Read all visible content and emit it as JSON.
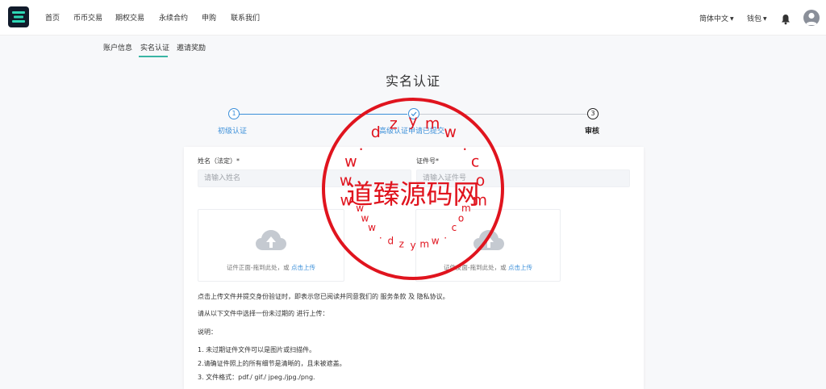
{
  "nav": {
    "items": [
      "首页",
      "币币交易",
      "期权交易",
      "永续合约",
      "申购",
      "联系我们"
    ],
    "language": "简体中文",
    "wallet": "钱包"
  },
  "subnav": {
    "tabs": [
      "账户信息",
      "实名认证",
      "邀请奖励"
    ],
    "active": "实名认证"
  },
  "page": {
    "title": "实名认证"
  },
  "steps": [
    {
      "number": "1",
      "label": "初级认证",
      "state": "done"
    },
    {
      "number": "2",
      "label": "高级认证申请已提交",
      "state": "done"
    },
    {
      "number": "3",
      "label": "审核",
      "state": "current"
    }
  ],
  "form": {
    "name_label": "姓名（法定）*",
    "name_placeholder": "请输入姓名",
    "id_label": "证件号*",
    "id_placeholder": "请输入证件号",
    "upload_front_text": "证件正面-拖到此处，或",
    "upload_back_text": "证件反面-拖到此处，或",
    "upload_link": "点击上传"
  },
  "info": {
    "agreement_prefix": "点击上传文件并提交身份验证时，即表示您已阅读并同意我们的",
    "terms": "服务条款",
    "and": "及",
    "privacy": "隐私协议。",
    "select_prompt": "请从以下文件中选择一份未过期的 进行上传：",
    "notes_title": "说明：",
    "notes": [
      "1. 未过期证件文件可以是图片或扫描件。",
      "2.请确证件照上的所有细节是清晰的，且未被遮盖。",
      "3. 文件格式：pdf./ gif./ jpeg./jpg./png."
    ]
  },
  "watermark": {
    "center_text": "道臻源码网",
    "ring_text": "www.dzymw.com"
  },
  "colors": {
    "accent": "#3ab5a4",
    "link": "#3b8fd9",
    "step_active": "#3b8fd9",
    "stamp_red": "#e0141e"
  }
}
